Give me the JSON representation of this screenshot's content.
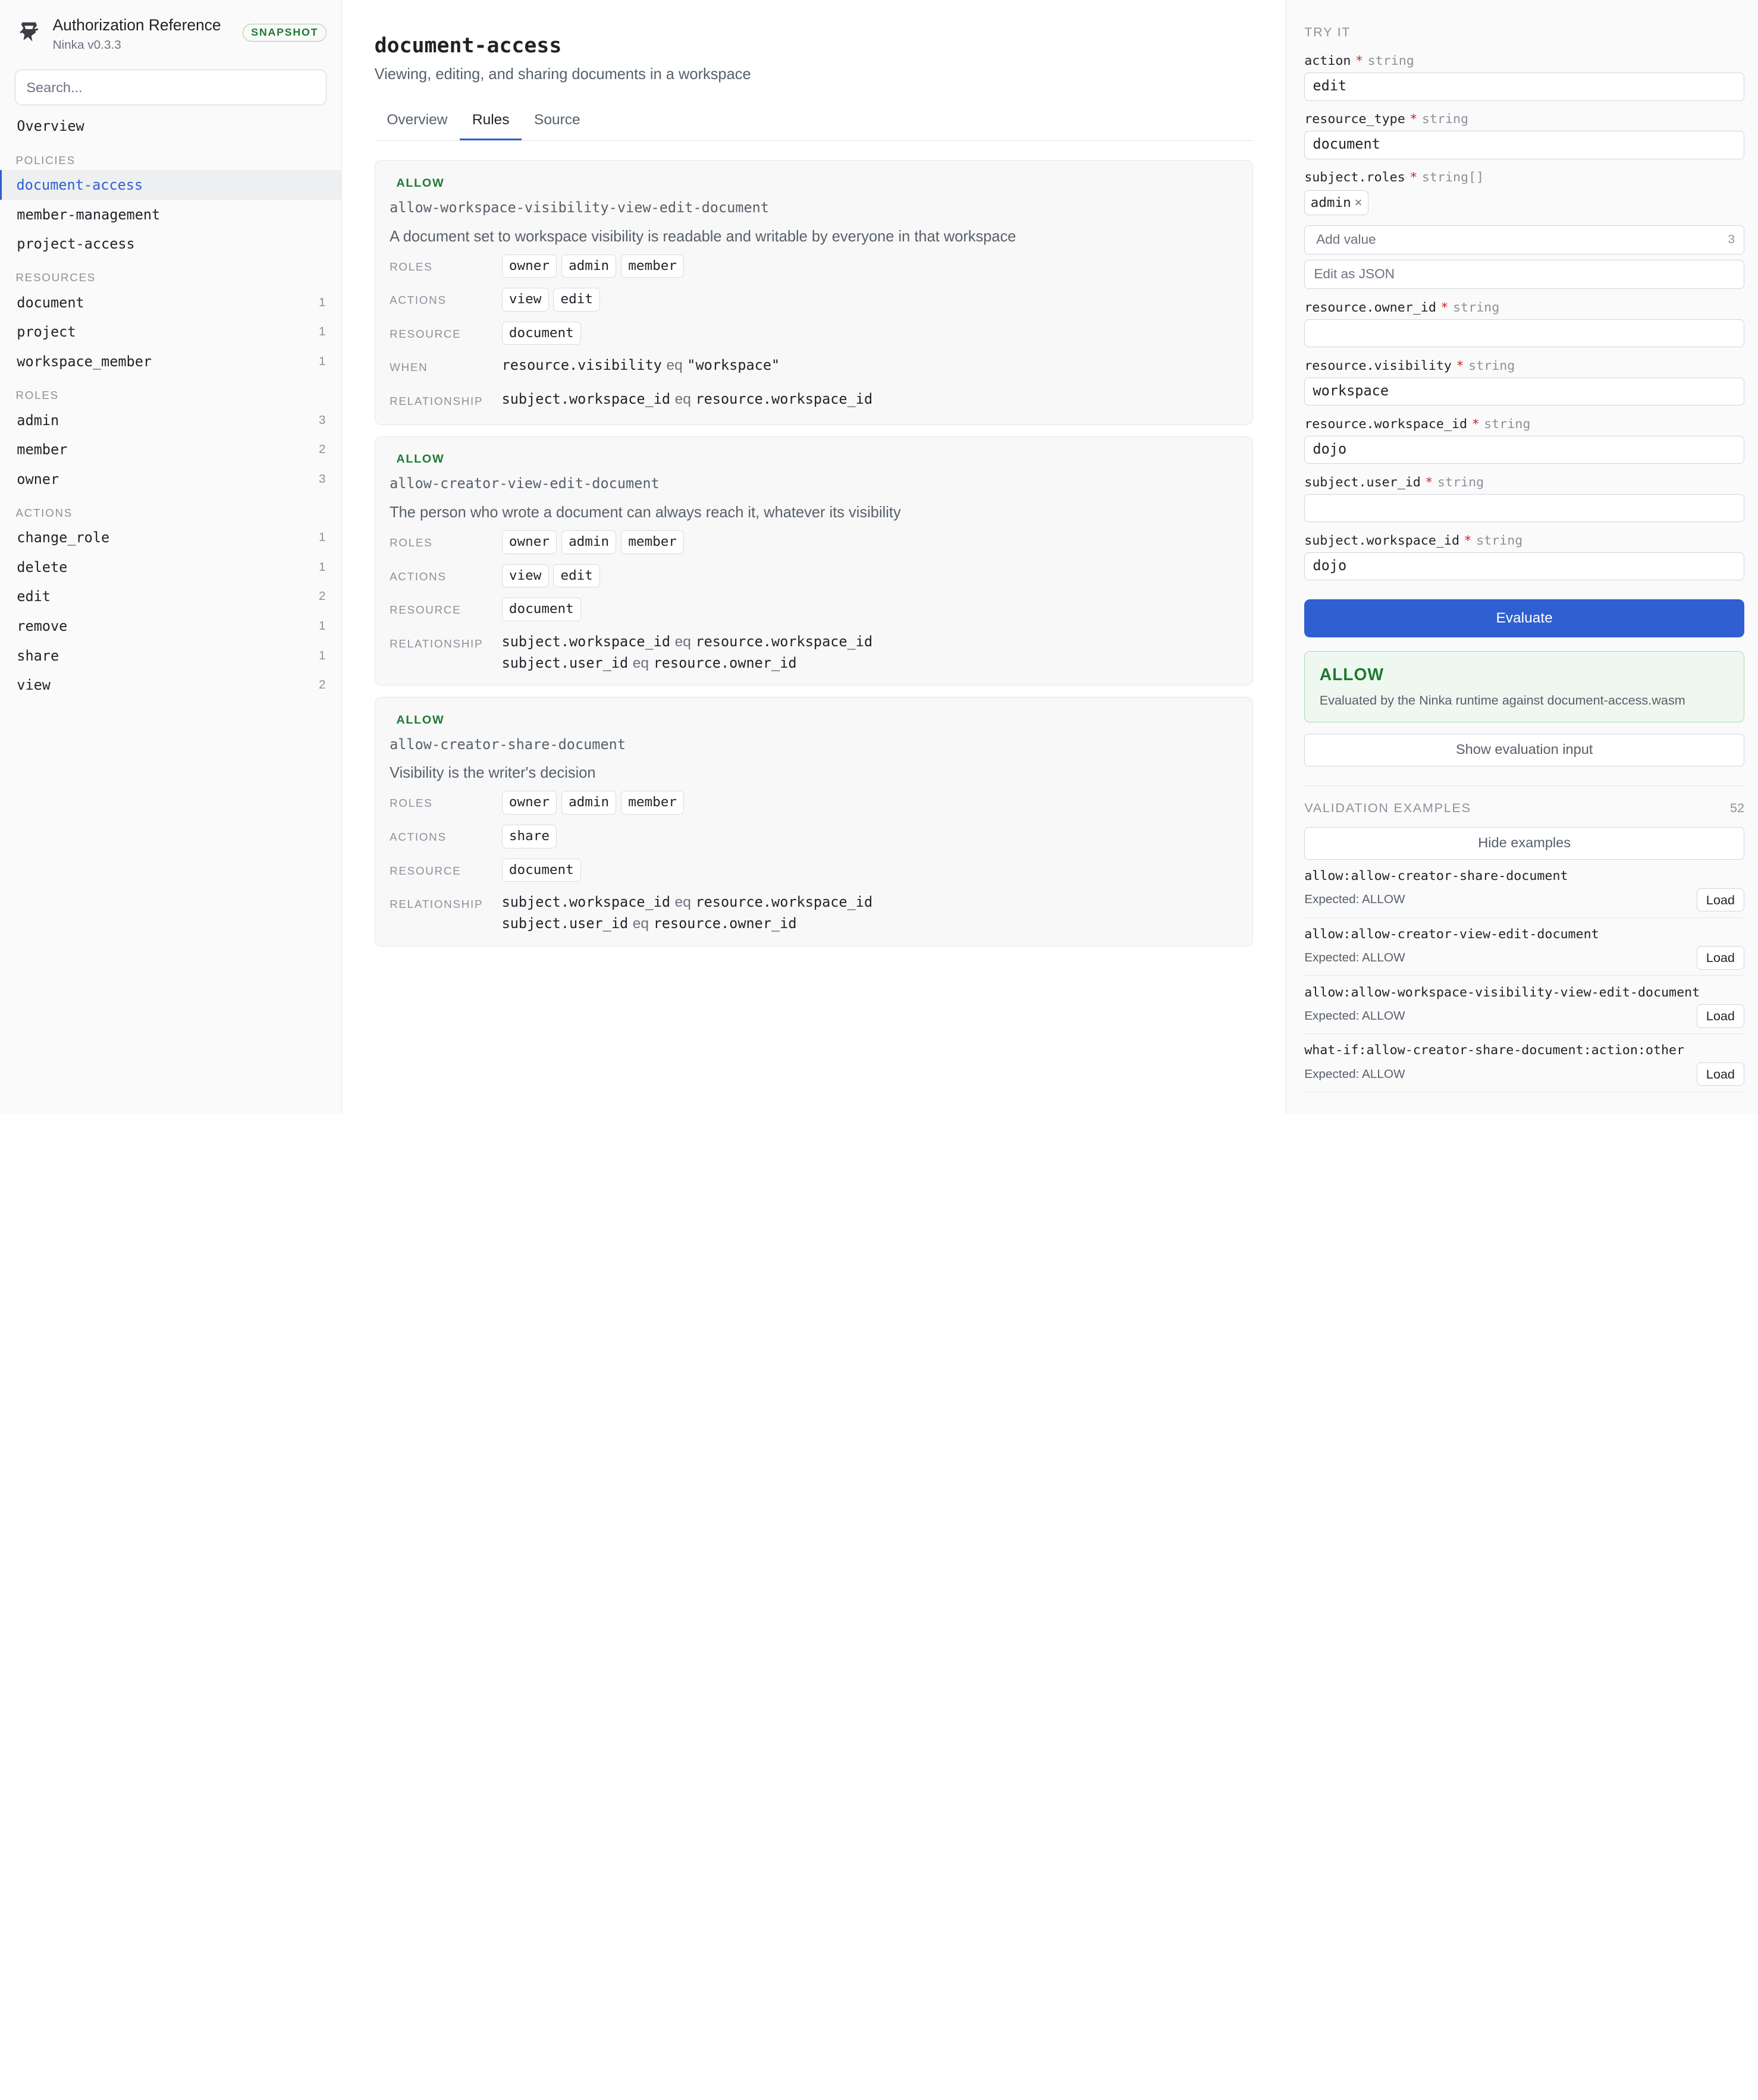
{
  "app": {
    "title": "Authorization Reference",
    "version": "Ninka v0.3.3",
    "badge": "SNAPSHOT",
    "search_placeholder": "Search..."
  },
  "sidebar": {
    "overview": "Overview",
    "sections": [
      {
        "title": "POLICIES",
        "items": [
          {
            "label": "document-access",
            "count": "",
            "active": true
          },
          {
            "label": "member-management",
            "count": ""
          },
          {
            "label": "project-access",
            "count": ""
          }
        ]
      },
      {
        "title": "RESOURCES",
        "items": [
          {
            "label": "document",
            "count": "1"
          },
          {
            "label": "project",
            "count": "1"
          },
          {
            "label": "workspace_member",
            "count": "1"
          }
        ]
      },
      {
        "title": "ROLES",
        "items": [
          {
            "label": "admin",
            "count": "3"
          },
          {
            "label": "member",
            "count": "2"
          },
          {
            "label": "owner",
            "count": "3"
          }
        ]
      },
      {
        "title": "ACTIONS",
        "items": [
          {
            "label": "change_role",
            "count": "1"
          },
          {
            "label": "delete",
            "count": "1"
          },
          {
            "label": "edit",
            "count": "2"
          },
          {
            "label": "remove",
            "count": "1"
          },
          {
            "label": "share",
            "count": "1"
          },
          {
            "label": "view",
            "count": "2"
          }
        ]
      }
    ]
  },
  "main": {
    "title": "document-access",
    "subtitle": "Viewing, editing, and sharing documents in a workspace",
    "tabs": [
      {
        "label": "Overview"
      },
      {
        "label": "Rules",
        "active": true
      },
      {
        "label": "Source"
      }
    ],
    "labels": {
      "roles": "ROLES",
      "actions": "ACTIONS",
      "resource": "RESOURCE",
      "when": "WHEN",
      "relationship": "RELATIONSHIP"
    },
    "rules": [
      {
        "effect": "ALLOW",
        "name": "allow-workspace-visibility-view-edit-document",
        "description": "A document set to workspace visibility is readable and writable by everyone in that workspace",
        "roles": [
          "owner",
          "admin",
          "member"
        ],
        "actions": [
          "view",
          "edit"
        ],
        "resource": "document",
        "when": [
          {
            "left": "resource.visibility",
            "op": "eq",
            "right": "\"workspace\""
          }
        ],
        "relationship": [
          {
            "left": "subject.workspace_id",
            "op": "eq",
            "right": "resource.workspace_id"
          }
        ]
      },
      {
        "effect": "ALLOW",
        "name": "allow-creator-view-edit-document",
        "description": "The person who wrote a document can always reach it, whatever its visibility",
        "roles": [
          "owner",
          "admin",
          "member"
        ],
        "actions": [
          "view",
          "edit"
        ],
        "resource": "document",
        "when": [],
        "relationship": [
          {
            "left": "subject.workspace_id",
            "op": "eq",
            "right": "resource.workspace_id"
          },
          {
            "left": "subject.user_id",
            "op": "eq",
            "right": "resource.owner_id"
          }
        ]
      },
      {
        "effect": "ALLOW",
        "name": "allow-creator-share-document",
        "description": "Visibility is the writer's decision",
        "roles": [
          "owner",
          "admin",
          "member"
        ],
        "actions": [
          "share"
        ],
        "resource": "document",
        "when": [],
        "relationship": [
          {
            "left": "subject.workspace_id",
            "op": "eq",
            "right": "resource.workspace_id"
          },
          {
            "left": "subject.user_id",
            "op": "eq",
            "right": "resource.owner_id"
          }
        ]
      }
    ]
  },
  "try_it": {
    "heading": "TRY IT",
    "fields": [
      {
        "name": "action",
        "required": "*",
        "type": "string",
        "value": "edit"
      },
      {
        "name": "resource_type",
        "required": "*",
        "type": "string",
        "value": "document"
      },
      {
        "name": "subject.roles",
        "required": "*",
        "type": "string[]",
        "tags": [
          "admin"
        ],
        "add_placeholder": "Add value",
        "add_count": "3",
        "edit_json": "Edit as JSON"
      },
      {
        "name": "resource.owner_id",
        "required": "*",
        "type": "string",
        "value": ""
      },
      {
        "name": "resource.visibility",
        "required": "*",
        "type": "string",
        "value": "workspace"
      },
      {
        "name": "resource.workspace_id",
        "required": "*",
        "type": "string",
        "value": "dojo"
      },
      {
        "name": "subject.user_id",
        "required": "*",
        "type": "string",
        "value": ""
      },
      {
        "name": "subject.workspace_id",
        "required": "*",
        "type": "string",
        "value": "dojo"
      }
    ],
    "evaluate_label": "Evaluate",
    "result": {
      "status": "ALLOW",
      "detail": "Evaluated by the Ninka runtime against document-access.wasm"
    },
    "show_input_label": "Show evaluation input"
  },
  "examples": {
    "heading": "VALIDATION EXAMPLES",
    "count": "52",
    "hide_label": "Hide examples",
    "load_label": "Load",
    "items": [
      {
        "name": "allow:allow-creator-share-document",
        "expected": "Expected: ALLOW"
      },
      {
        "name": "allow:allow-creator-view-edit-document",
        "expected": "Expected: ALLOW"
      },
      {
        "name": "allow:allow-workspace-visibility-view-edit-document",
        "expected": "Expected: ALLOW"
      },
      {
        "name": "what-if:allow-creator-share-document:action:other",
        "expected": "Expected: ALLOW"
      }
    ]
  }
}
